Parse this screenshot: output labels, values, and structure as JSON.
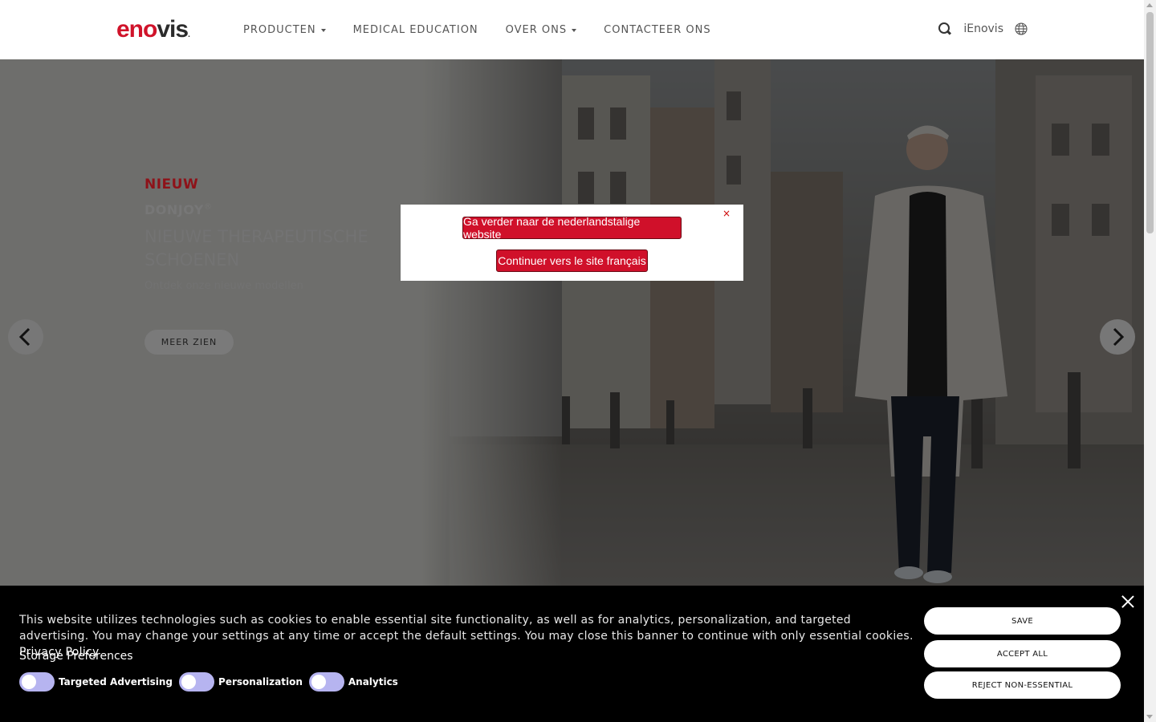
{
  "header": {
    "logo": {
      "part1": "en",
      "part2": "o",
      "part3": "vis",
      "suffix": "."
    },
    "nav": [
      {
        "label": "PRODUCTEN",
        "has_dropdown": true
      },
      {
        "label": "MEDICAL EDUCATION",
        "has_dropdown": false
      },
      {
        "label": "OVER ONS",
        "has_dropdown": true
      },
      {
        "label": "CONTACTEER ONS",
        "has_dropdown": false
      }
    ],
    "ienovis": "iEnovis",
    "icons": {
      "search": "search-icon",
      "language": "globe-icon"
    }
  },
  "hero": {
    "tag": "NIEUW",
    "brand": "DONJOY",
    "brand_mark": "®",
    "title": "NIEUWE THERAPEUTISCHE SCHOENEN",
    "subtitle": "Ontdek onze nieuwe modellen",
    "button": "MEER ZIEN",
    "icons": {
      "prev": "chevron-left-icon",
      "next": "chevron-right-icon"
    }
  },
  "modal": {
    "close": "×",
    "option_nl": "Ga verder naar de nederlandstalige website",
    "option_fr": "Continuer vers le site français"
  },
  "cookie_banner": {
    "text": "This website utilizes technologies such as cookies to enable essential site functionality, as well as for analytics, personalization, and targeted advertising. You may change your settings at any time or accept the default settings. You may close this banner to continue with only essential cookies.",
    "privacy_link": "Privacy Policy",
    "storage_title": "Storage Preferences",
    "toggles": [
      {
        "label": "Targeted Advertising",
        "on": false
      },
      {
        "label": "Personalization",
        "on": false
      },
      {
        "label": "Analytics",
        "on": false
      }
    ],
    "buttons": {
      "save": "SAVE",
      "accept": "ACCEPT ALL",
      "reject": "REJECT NON-ESSENTIAL"
    }
  },
  "colors": {
    "brand_red": "#d0132a",
    "toggle": "#b6b4f0",
    "banner_bg": "#000000"
  }
}
